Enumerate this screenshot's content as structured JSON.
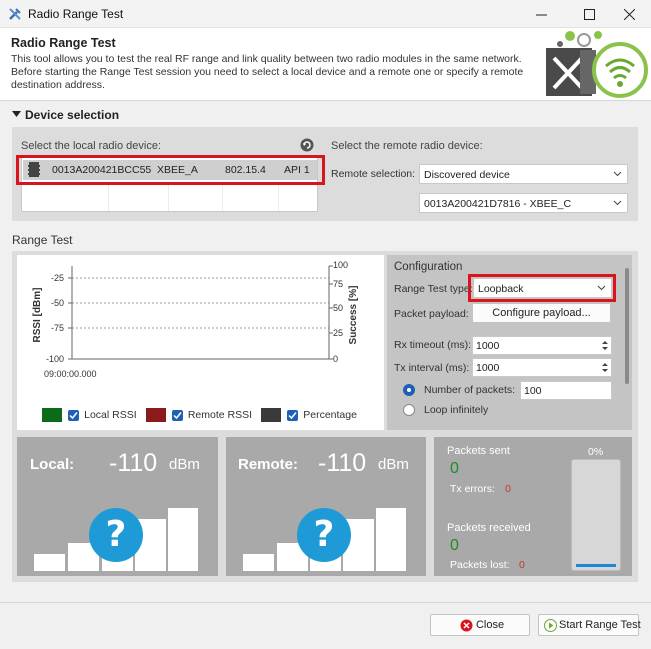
{
  "window": {
    "title": "Radio Range Test"
  },
  "header": {
    "title": "Radio Range Test",
    "description": "This tool allows you to test the real RF range and link quality between two radio modules in the same network. Before starting the Range Test session you need to select a local device and a remote one or specify a remote destination address."
  },
  "device_selection": {
    "section_label": "Device selection",
    "local_label": "Select the local radio device:",
    "local_device": {
      "address": "0013A200421BCC55",
      "name": "XBEE_A",
      "protocol": "802.15.4",
      "mode": "API 1"
    },
    "remote_label": "Select the remote radio device:",
    "remote_selection_label": "Remote selection:",
    "remote_selection_value": "Discovered device",
    "remote_device_value": "0013A200421D7816 - XBEE_C"
  },
  "range_test": {
    "section_label": "Range Test",
    "chart": {
      "ylabel_left": "RSSI [dBm]",
      "ylabel_right": "Success [%]",
      "left_ticks": [
        "-25",
        "-50",
        "-75",
        "-100"
      ],
      "right_ticks": [
        "100",
        "75",
        "50",
        "25",
        "0"
      ],
      "x_tick": "09:00:00.000"
    },
    "legend": {
      "local": "Local RSSI",
      "remote": "Remote RSSI",
      "percentage": "Percentage",
      "colors": {
        "local": "#0b6b1b",
        "remote": "#8b1a1a",
        "percentage": "#3a3a3a"
      }
    },
    "configuration": {
      "title": "Configuration",
      "type_label": "Range Test type:",
      "type_value": "Loopback",
      "payload_label": "Packet payload:",
      "payload_button": "Configure payload...",
      "rx_timeout_label": "Rx timeout (ms):",
      "rx_timeout_value": "1000",
      "tx_interval_label": "Tx interval (ms):",
      "tx_interval_value": "1000",
      "num_packets_label": "Number of packets:",
      "num_packets_value": "100",
      "loop_label": "Loop infinitely"
    },
    "local": {
      "label": "Local:",
      "value": "-110",
      "unit": "dBm"
    },
    "remote": {
      "label": "Remote:",
      "value": "-110",
      "unit": "dBm"
    },
    "stats": {
      "sent_label": "Packets sent",
      "sent_value": "0",
      "tx_errors_label": "Tx errors:",
      "tx_errors_value": "0",
      "received_label": "Packets received",
      "received_value": "0",
      "lost_label": "Packets lost:",
      "lost_value": "0",
      "percent": "0%"
    }
  },
  "footer": {
    "close_label": "Close",
    "start_label": "Start Range Test"
  }
}
